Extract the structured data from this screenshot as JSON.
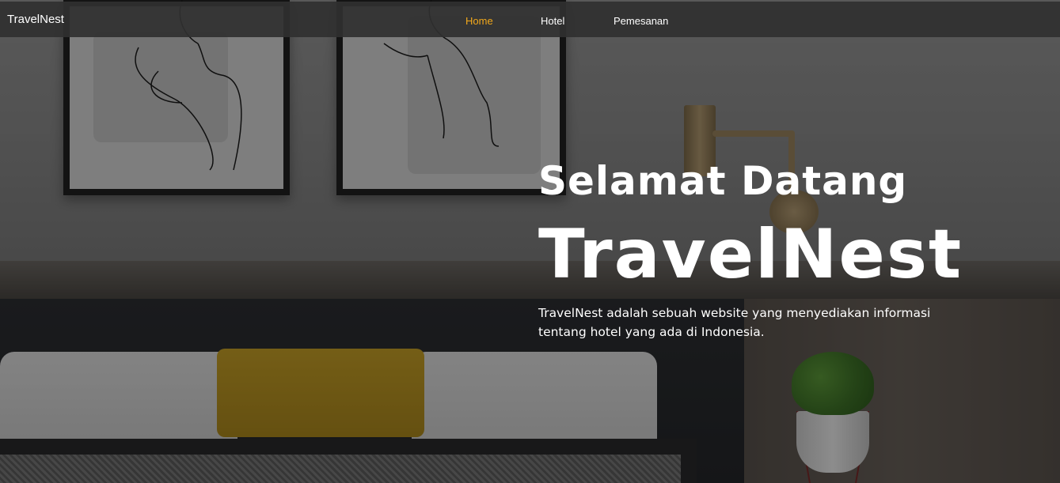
{
  "navbar": {
    "brand": "TravelNest",
    "links": [
      {
        "label": "Home",
        "active": true
      },
      {
        "label": "Hotel",
        "active": false
      },
      {
        "label": "Pemesanan",
        "active": false
      }
    ],
    "active_color": "#f2a81b"
  },
  "hero": {
    "title": "Selamat Datang",
    "brand": "TravelNest",
    "description": "TravelNest adalah sebuah website yang menyediakan informasi tentang hotel yang ada di Indonesia."
  }
}
